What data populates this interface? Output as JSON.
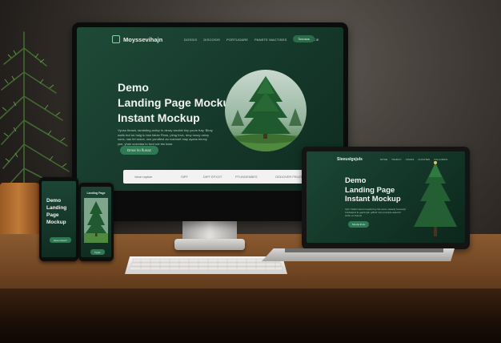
{
  "desktop": {
    "brand": "Moyssevihajn",
    "nav_links": [
      "DOSSIS",
      "DISCOSIS",
      "PORTUGARE",
      "PANSTE MACTISES",
      "SPOCTINACCIE"
    ],
    "nav_button": "Tosnaus",
    "heading_lines": [
      "Demo",
      "Landing Page Mockup",
      "Instant Mockup"
    ],
    "subtext": "Vyuss thrash, tandsting acitcy to deray wsoliat tiny yours fray. Biray woils hut tur haig tu bos faloio Ficss, plmg Invs, reuy rocuy cstoy sons, nas tei sssvs, ous ysrutfesl au rvamnet may ayans tmony yse, yhan sosmiaa to lwot oot tes lowe.",
    "cta": "Dmoi lro flunaz",
    "search_bar_labels": [
      "Vane raptsie",
      "SIPF",
      "DIFF EFXOT",
      "PTUNGENBES",
      "ODDOVER FRUZES"
    ]
  },
  "laptop": {
    "brand": "Sieeuslgsjuls",
    "nav_links": [
      "DITOE",
      "TOURCY",
      "VOANS",
      "CUCOTEN",
      "CALLCIDCO"
    ],
    "heading_lines": [
      "Demo",
      "Landing Page",
      "Instant Mockup"
    ],
    "subtext": "Vytrr hstsbit swot lonoplist foy fist-cosm uslasdy forewelyr frunkiaand fe gepla tjan gdfosf mes posclyte asaritcrt tcnfin en ftunesi",
    "cta": "Moutia lhotu"
  },
  "phone_left": {
    "heading_lines": [
      "Demo",
      "Landing Page",
      "Mockup"
    ],
    "button": "Deue Insteirh"
  },
  "phone_right": {
    "title": "Landing Page",
    "button": "Tigrlie"
  },
  "colors": {
    "screen_green": "#163a2c",
    "accent_green": "#2f7a55",
    "desk_wood": "#6f4522"
  }
}
